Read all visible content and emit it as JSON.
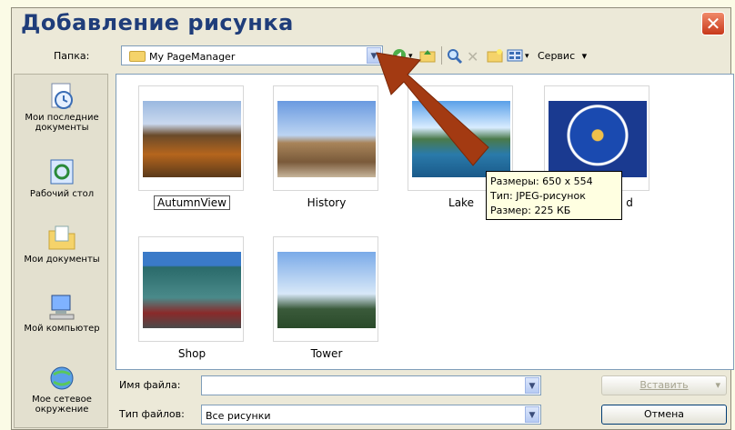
{
  "dialog": {
    "title": "Добавление рисунка",
    "close_glyph": "✕"
  },
  "folder_row": {
    "label": "Папка:",
    "value": "My PageManager",
    "tools_label": "Сервис",
    "tools_arrow": "▾"
  },
  "places": [
    {
      "label": "Мои последние документы",
      "icon": "recent-documents-icon"
    },
    {
      "label": "Рабочий стол",
      "icon": "desktop-icon"
    },
    {
      "label": "Мои документы",
      "icon": "my-documents-icon"
    },
    {
      "label": "Мой компьютер",
      "icon": "my-computer-icon"
    },
    {
      "label": "Мое сетевое окружение",
      "icon": "network-places-icon"
    }
  ],
  "files": [
    {
      "name": "AutumnView",
      "selected": true
    },
    {
      "name": "History",
      "selected": false
    },
    {
      "name": "Lake",
      "selected": false
    },
    {
      "name": "d",
      "selected": false
    },
    {
      "name": "Shop",
      "selected": false
    },
    {
      "name": "Tower",
      "selected": false
    }
  ],
  "tooltip": {
    "line1": "Размеры: 650 x 554",
    "line2": "Тип: JPEG-рисунок",
    "line3": "Размер: 225 КБ"
  },
  "filename_row": {
    "label": "Имя файла:",
    "value": ""
  },
  "filetype_row": {
    "label": "Тип файлов:",
    "value": "Все рисунки"
  },
  "buttons": {
    "insert": "Вставить",
    "insert_arrow": "▾",
    "cancel": "Отмена"
  },
  "colors": {
    "title": "#1f3d7a",
    "arrow": "#a33a12",
    "dialog_bg": "#ece9d8"
  }
}
